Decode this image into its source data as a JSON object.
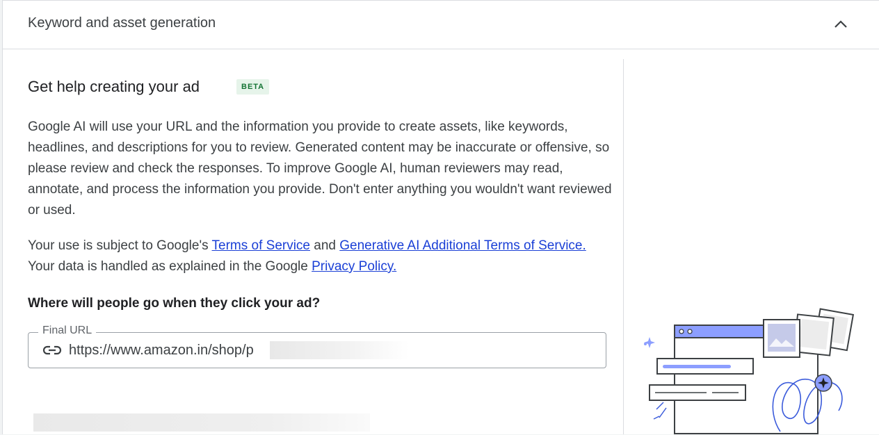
{
  "section": {
    "title": "Keyword and asset generation",
    "collapse_icon": "chevron-up-icon"
  },
  "main": {
    "heading": "Get help creating your ad",
    "badge": "BETA",
    "disclaimer": "Google AI will use your URL and the information you provide to create assets, like keywords, headlines, and descriptions for you to review. Generated content may be inaccurate or offensive, so please review and check the responses. To improve Google AI, human reviewers may read, annotate, and process the information you provide. Don't enter anything you wouldn't want reviewed or used.",
    "terms": {
      "prefix": "Your use is subject to Google's ",
      "tos_link": "Terms of Service",
      "and": " and ",
      "genai_link": "Generative AI Additional Terms of Service.",
      "middle": " Your data is handled as explained in the Google ",
      "privacy_link": "Privacy Policy."
    },
    "question": "Where will people go when they click your ad?",
    "final_url": {
      "label": "Final URL",
      "value": "https://www.amazon.in/shop/p",
      "icon": "link-icon"
    },
    "next_question_partial": "V"
  },
  "colors": {
    "accent": "#8c9eff",
    "badge_bg": "#e6f4ea",
    "badge_text": "#137333",
    "link": "#1a3fd6"
  }
}
